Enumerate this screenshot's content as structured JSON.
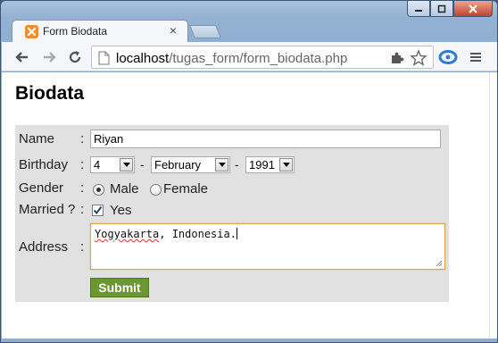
{
  "window": {
    "tab_title": "Form Biodata",
    "tab_close": "×"
  },
  "toolbar": {
    "url_host": "localhost",
    "url_path": "/tugas_form/form_biodata.php"
  },
  "page": {
    "heading": "Biodata"
  },
  "form": {
    "colon": ":",
    "separator": "-",
    "name": {
      "label": "Name",
      "value": "Riyan"
    },
    "birthday": {
      "label": "Birthday",
      "day": "4",
      "month": "February",
      "year": "1991"
    },
    "gender": {
      "label": "Gender",
      "options": [
        "Male",
        "Female"
      ],
      "selected": "Male"
    },
    "married": {
      "label": "Married ?",
      "option": "Yes",
      "checked": true
    },
    "address": {
      "label": "Address",
      "value_word_1": "Yogyakarta",
      "value_rest": ", Indonesia."
    },
    "submit_label": "Submit"
  },
  "colors": {
    "submit_bg": "#6a9730",
    "form_bg": "#e1e1e1",
    "textarea_focus": "#d6a44f",
    "favicon": "#f18d2f"
  },
  "icons": [
    "xampp-favicon",
    "back-arrow-icon",
    "forward-arrow-icon",
    "reload-icon",
    "page-icon",
    "extension-icon",
    "star-icon",
    "lastpass-icon",
    "menu-icon"
  ]
}
